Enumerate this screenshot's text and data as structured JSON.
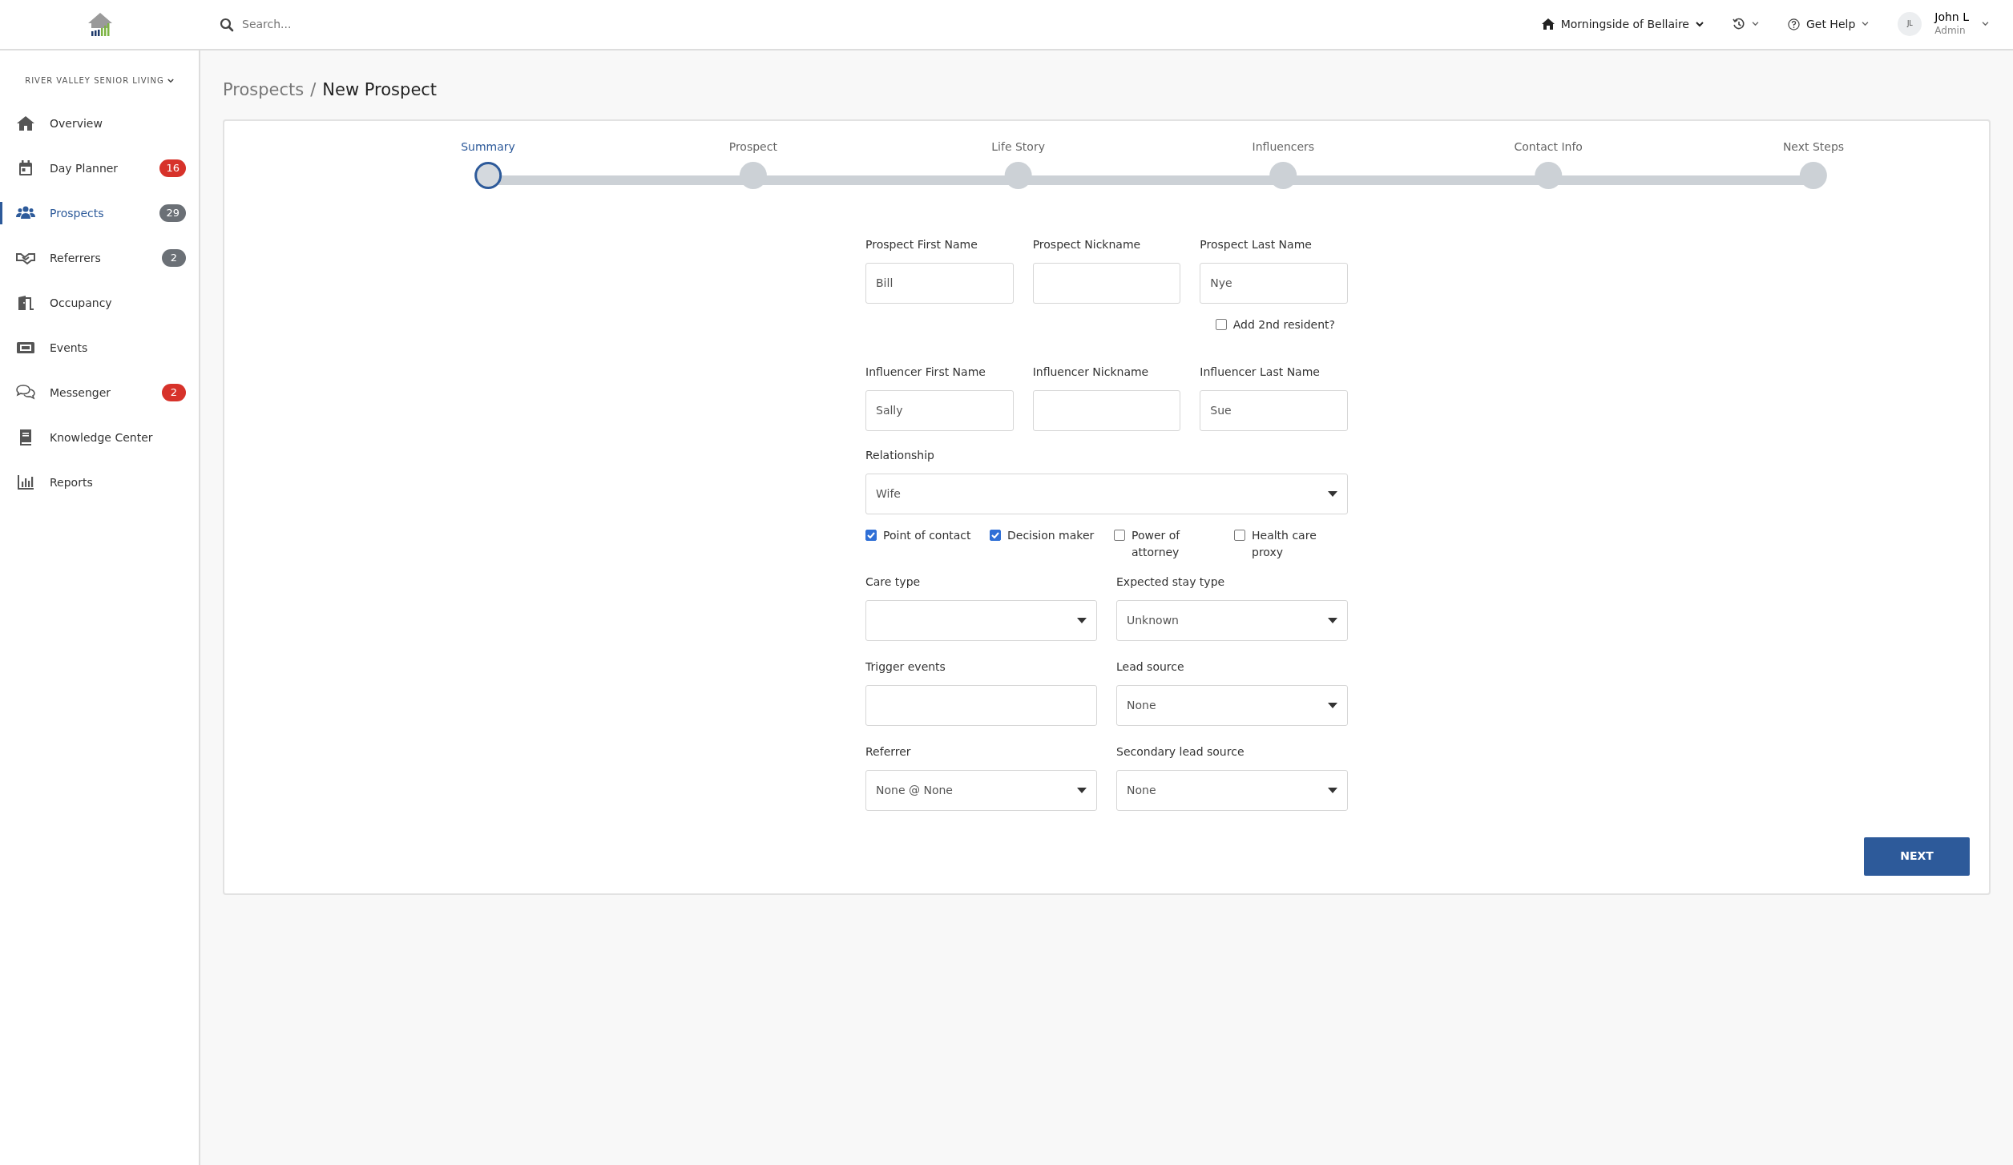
{
  "topbar": {
    "search": {
      "placeholder": "Search..."
    },
    "location": "Morningside of Bellaire",
    "help": "Get Help",
    "user": {
      "initials": "JL",
      "name": "John L",
      "role": "Admin"
    }
  },
  "sidebar": {
    "organization": "RIVER VALLEY SENIOR LIVING",
    "items": [
      {
        "label": "Overview",
        "selected": false
      },
      {
        "label": "Day Planner",
        "selected": false,
        "badge": {
          "text": "16",
          "color": "#d7322a"
        }
      },
      {
        "label": "Prospects",
        "selected": true,
        "badge": {
          "text": "29",
          "color": "#6b7076"
        }
      },
      {
        "label": "Referrers",
        "selected": false,
        "badge": {
          "text": "2",
          "color": "#6b7076"
        }
      },
      {
        "label": "Occupancy",
        "selected": false
      },
      {
        "label": "Events",
        "selected": false
      },
      {
        "label": "Messenger",
        "selected": false,
        "badge": {
          "text": "2",
          "color": "#d7322a"
        }
      },
      {
        "label": "Knowledge Center",
        "selected": false
      },
      {
        "label": "Reports",
        "selected": false
      }
    ]
  },
  "breadcrumb": {
    "items": [
      "Prospects",
      "New Prospect"
    ],
    "separator": "/"
  },
  "stepper": {
    "steps": [
      {
        "label": "Summary",
        "selected": true
      },
      {
        "label": "Prospect",
        "selected": false
      },
      {
        "label": "Life Story",
        "selected": false
      },
      {
        "label": "Influencers",
        "selected": false
      },
      {
        "label": "Contact Info",
        "selected": false
      },
      {
        "label": "Next Steps",
        "selected": false
      }
    ]
  },
  "form": {
    "prospect_fields": [
      {
        "label": "Prospect First Name",
        "value": "Bill"
      },
      {
        "label": "Prospect Nickname"
      },
      {
        "label": "Prospect Last Name",
        "value": "Nye"
      }
    ],
    "add_resident": {
      "label": "Add 2nd resident?",
      "checked": false
    },
    "influencer_fields": [
      {
        "label": "Influencer First Name",
        "value": "Sally"
      },
      {
        "label": "Influencer Nickname"
      },
      {
        "label": "Influencer Last Name",
        "value": "Sue"
      }
    ],
    "relationship": {
      "label": "Relationship",
      "value": "Wife"
    },
    "roles": [
      {
        "label": "Point of contact",
        "checked": true
      },
      {
        "label": "Decision maker",
        "checked": true
      },
      {
        "label": "Power of attorney",
        "checked": false
      },
      {
        "label": "Health care proxy",
        "checked": false
      }
    ],
    "details": [
      {
        "label": "Care type",
        "kind": "select"
      },
      {
        "label": "Expected stay type",
        "kind": "select",
        "value": "Unknown"
      },
      {
        "label": "Trigger events",
        "kind": "text"
      },
      {
        "label": "Lead source",
        "kind": "select",
        "value": "None"
      },
      {
        "label": "Referrer",
        "kind": "select",
        "value": "None @ None"
      },
      {
        "label": "Secondary lead source",
        "kind": "select",
        "value": "None"
      }
    ]
  },
  "next_button": "NEXT"
}
